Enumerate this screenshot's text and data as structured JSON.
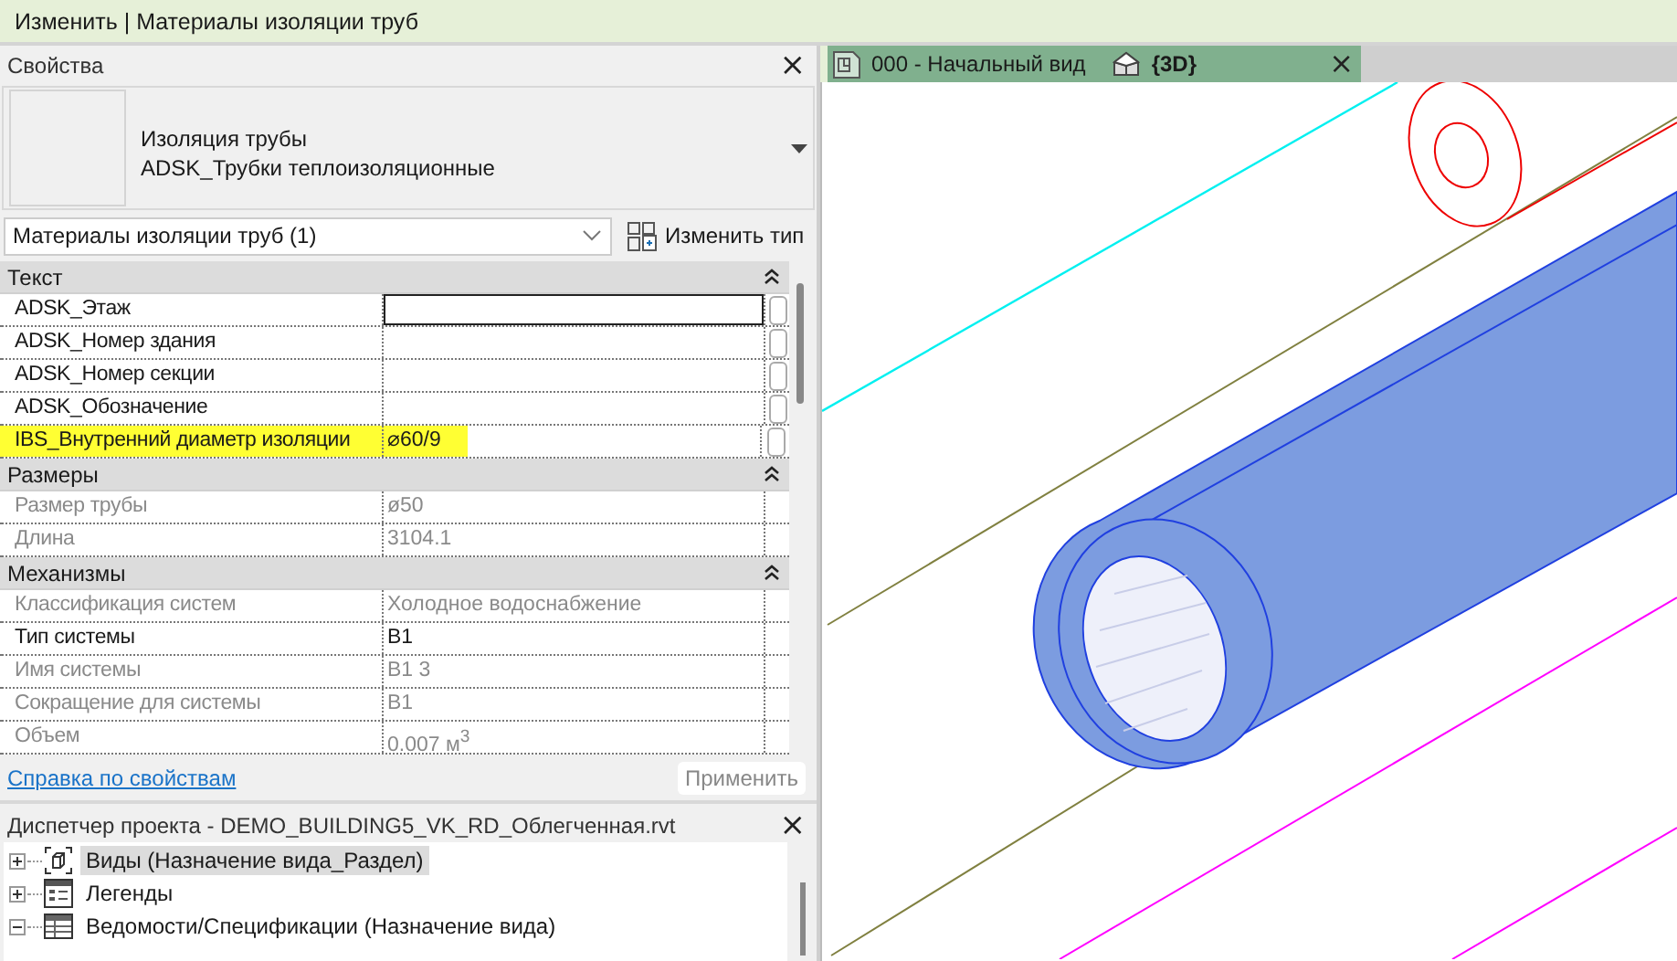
{
  "title_bar": {
    "title": "Изменить | Материалы изоляции труб"
  },
  "properties": {
    "title": "Свойства",
    "type_family": "Изоляция трубы",
    "type_name": "ADSK_Трубки теплоизоляционные",
    "instance_selector": "Материалы изоляции труб (1)",
    "edit_type_button": "Изменить тип",
    "groups": [
      {
        "name": "Текст",
        "expanded": true,
        "rows": [
          {
            "name": "ADSK_Этаж",
            "value": "",
            "disabled": false,
            "editing": true,
            "highlighted": false,
            "link_button": true
          },
          {
            "name": "ADSK_Номер здания",
            "value": "",
            "disabled": false,
            "editing": false,
            "highlighted": false,
            "link_button": true
          },
          {
            "name": "ADSK_Номер секции",
            "value": "",
            "disabled": false,
            "editing": false,
            "highlighted": false,
            "link_button": true
          },
          {
            "name": "ADSK_Обозначение",
            "value": "",
            "disabled": false,
            "editing": false,
            "highlighted": false,
            "link_button": true
          },
          {
            "name": "IBS_Внутренний диаметр изоляции",
            "value": "⌀60/9",
            "disabled": false,
            "editing": false,
            "highlighted": true,
            "link_button": true
          }
        ]
      },
      {
        "name": "Размеры",
        "expanded": true,
        "rows": [
          {
            "name": "Размер трубы",
            "value": "ø50",
            "disabled": true,
            "editing": false,
            "highlighted": false,
            "link_button": false
          },
          {
            "name": "Длина",
            "value": "3104.1",
            "disabled": true,
            "editing": false,
            "highlighted": false,
            "link_button": false
          }
        ]
      },
      {
        "name": "Механизмы",
        "expanded": true,
        "rows": [
          {
            "name": "Классификация систем",
            "value": "Холодное водоснабжение",
            "disabled": true,
            "editing": false,
            "highlighted": false,
            "link_button": false
          },
          {
            "name": "Тип системы",
            "value": "В1",
            "disabled": false,
            "editing": false,
            "highlighted": false,
            "link_button": false
          },
          {
            "name": "Имя системы",
            "value": "В1 3",
            "disabled": true,
            "editing": false,
            "highlighted": false,
            "link_button": false
          },
          {
            "name": "Сокращение для системы",
            "value": "В1",
            "disabled": true,
            "editing": false,
            "highlighted": false,
            "link_button": false
          },
          {
            "name": "Объем",
            "value": "0.007 м$^{3}$",
            "disabled": true,
            "editing": false,
            "highlighted": false,
            "link_button": false
          }
        ]
      }
    ],
    "help_link": "Справка по свойствам",
    "apply_button": {
      "label": "Применить",
      "disabled": true
    },
    "close": "×"
  },
  "project_browser": {
    "title": "Диспетчер проекта - DEMO_BUILDING5_VK_RD_Облегченная.rvt",
    "close": "×",
    "items": [
      {
        "kind": "views",
        "label": "Виды (Назначение вида_Раздел)",
        "expanded": false,
        "selected": true
      },
      {
        "kind": "legends",
        "label": "Легенды",
        "expanded": false,
        "selected": false
      },
      {
        "kind": "schedules",
        "label": "Ведомости/Спецификации (Назначение вида)",
        "expanded": true,
        "selected": false
      }
    ]
  },
  "view_tabs": [
    {
      "kind": "plan",
      "label": "000 - Начальный вид",
      "selected": false
    },
    {
      "kind": "view3d",
      "label": "{3D}",
      "selected": true
    }
  ],
  "view_tab_close": "×"
}
